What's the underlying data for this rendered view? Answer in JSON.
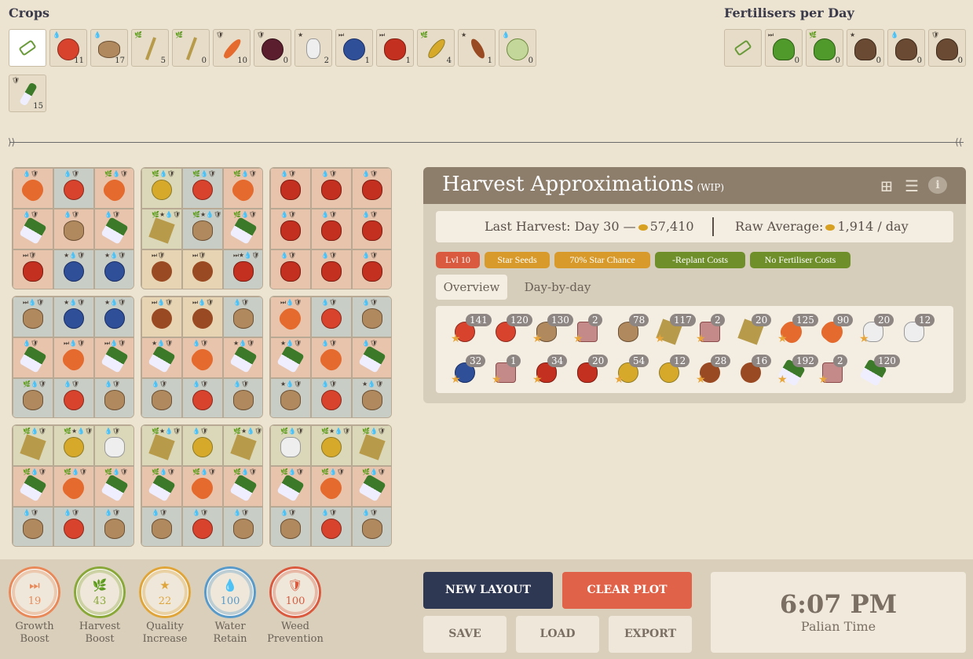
{
  "crops_title": "Crops",
  "fert_title": "Fertilisers per Day",
  "crops": [
    {
      "name": "eraser",
      "count": ""
    },
    {
      "name": "tomato",
      "count": "11",
      "mods": "💧"
    },
    {
      "name": "potato",
      "count": "17",
      "mods": "💧"
    },
    {
      "name": "wheat",
      "count": "5",
      "mods": "🌿"
    },
    {
      "name": "wheat",
      "count": "0",
      "mods": "🌿"
    },
    {
      "name": "carrot",
      "count": "10",
      "mods": "🛡"
    },
    {
      "name": "onion",
      "count": "0",
      "mods": "🛡"
    },
    {
      "name": "cotton",
      "count": "2",
      "mods": "★"
    },
    {
      "name": "blue",
      "count": "1",
      "mods": "⏭"
    },
    {
      "name": "apple",
      "count": "1",
      "mods": "⏭"
    },
    {
      "name": "corn",
      "count": "4",
      "mods": "🌿"
    },
    {
      "name": "chili",
      "count": "1",
      "mods": "★"
    },
    {
      "name": "cabbage",
      "count": "0",
      "mods": "💧"
    },
    {
      "name": "leek",
      "count": "15",
      "mods": "🛡"
    }
  ],
  "fertilisers": [
    {
      "name": "eraser",
      "count": ""
    },
    {
      "name": "green",
      "count": "0",
      "mods": "⏭"
    },
    {
      "name": "green",
      "count": "0",
      "mods": "🌿"
    },
    {
      "name": "manure",
      "count": "0",
      "mods": "★"
    },
    {
      "name": "manure",
      "count": "0",
      "mods": "💧"
    },
    {
      "name": "manure",
      "count": "0",
      "mods": "🛡"
    }
  ],
  "plots": [
    [
      [
        "carrot",
        "salmon",
        "💧🛡"
      ],
      [
        "tomato",
        "blue",
        "💧🛡"
      ],
      [
        "carrot",
        "salmon",
        "🌿💧🛡"
      ],
      [
        "leek",
        "salmon",
        "💧🛡"
      ],
      [
        "potato",
        "salmon",
        "💧🛡"
      ],
      [
        "leek",
        "salmon",
        "💧🛡"
      ],
      [
        "apple",
        "salmon",
        "⏭🛡"
      ],
      [
        "blue",
        "blue",
        "★💧🛡"
      ],
      [
        "blue",
        "blue",
        "★💧🛡"
      ]
    ],
    [
      [
        "corn",
        "olive",
        "🌿💧🛡"
      ],
      [
        "tomato",
        "blue",
        "🌿💧🛡"
      ],
      [
        "carrot",
        "salmon",
        "🌿💧🛡"
      ],
      [
        "wheat",
        "olive",
        "🌿★💧🛡"
      ],
      [
        "potato",
        "blue",
        "🌿★💧🛡"
      ],
      [
        "leek",
        "salmon",
        "🌿💧🛡"
      ],
      [
        "chili",
        "tan",
        "⏭🛡"
      ],
      [
        "chili",
        "tan",
        "⏭🛡"
      ],
      [
        "apple",
        "blue",
        "⏭★💧🛡"
      ]
    ],
    [
      [
        "apple",
        "salmon",
        "💧🛡"
      ],
      [
        "apple",
        "salmon",
        "💧🛡"
      ],
      [
        "apple",
        "salmon",
        "💧🛡"
      ],
      [
        "apple",
        "salmon",
        "💧🛡"
      ],
      [
        "apple",
        "salmon",
        "💧🛡"
      ],
      [
        "apple",
        "salmon",
        "💧🛡"
      ],
      [
        "apple",
        "salmon",
        "💧🛡"
      ],
      [
        "apple",
        "salmon",
        "💧🛡"
      ],
      [
        "apple",
        "salmon",
        "💧🛡"
      ]
    ],
    [
      [
        "potato",
        "blue",
        "⏭💧🛡"
      ],
      [
        "blue",
        "blue",
        "★💧🛡"
      ],
      [
        "blue",
        "blue",
        "★💧🛡"
      ],
      [
        "leek",
        "salmon",
        "💧🛡"
      ],
      [
        "carrot",
        "salmon",
        "⏭💧🛡"
      ],
      [
        "leek",
        "salmon",
        "⏭💧🛡"
      ],
      [
        "potato",
        "blue",
        "🌿💧🛡"
      ],
      [
        "tomato",
        "blue",
        "💧🛡"
      ],
      [
        "potato",
        "blue",
        "💧🛡"
      ]
    ],
    [
      [
        "chili",
        "tan",
        "⏭💧🛡"
      ],
      [
        "chili",
        "tan",
        "⏭💧🛡"
      ],
      [
        "potato",
        "blue",
        "💧🛡"
      ],
      [
        "leek",
        "salmon",
        "★💧🛡"
      ],
      [
        "carrot",
        "salmon",
        "💧🛡"
      ],
      [
        "leek",
        "salmon",
        "★💧🛡"
      ],
      [
        "potato",
        "blue",
        "💧🛡"
      ],
      [
        "tomato",
        "blue",
        "💧🛡"
      ],
      [
        "potato",
        "blue",
        "💧🛡"
      ]
    ],
    [
      [
        "carrot",
        "salmon",
        "⏭💧🛡"
      ],
      [
        "tomato",
        "blue",
        "💧🛡"
      ],
      [
        "potato",
        "blue",
        "💧🛡"
      ],
      [
        "leek",
        "salmon",
        "★💧🛡"
      ],
      [
        "carrot",
        "salmon",
        "💧🛡"
      ],
      [
        "leek",
        "salmon",
        "💧🛡"
      ],
      [
        "potato",
        "blue",
        "★💧🛡"
      ],
      [
        "tomato",
        "blue",
        "💧🛡"
      ],
      [
        "potato",
        "blue",
        "★💧🛡"
      ]
    ],
    [
      [
        "wheat",
        "olive",
        "🌿💧🛡"
      ],
      [
        "corn",
        "olive",
        "🌿★💧🛡"
      ],
      [
        "cotton",
        "olive",
        "💧🛡"
      ],
      [
        "leek",
        "salmon",
        "🌿💧🛡"
      ],
      [
        "carrot",
        "salmon",
        "🌿💧🛡"
      ],
      [
        "leek",
        "salmon",
        "🌿💧🛡"
      ],
      [
        "potato",
        "blue",
        "💧🛡"
      ],
      [
        "tomato",
        "blue",
        "💧🛡"
      ],
      [
        "potato",
        "blue",
        "💧🛡"
      ]
    ],
    [
      [
        "wheat",
        "olive",
        "🌿★💧🛡"
      ],
      [
        "corn",
        "olive",
        "💧🛡"
      ],
      [
        "wheat",
        "olive",
        "🌿★💧🛡"
      ],
      [
        "leek",
        "salmon",
        "🌿💧🛡"
      ],
      [
        "carrot",
        "salmon",
        "🌿💧🛡"
      ],
      [
        "leek",
        "salmon",
        "🌿💧🛡"
      ],
      [
        "potato",
        "blue",
        "💧🛡"
      ],
      [
        "tomato",
        "blue",
        "💧🛡"
      ],
      [
        "potato",
        "blue",
        "💧🛡"
      ]
    ],
    [
      [
        "cotton",
        "olive",
        "🌿💧🛡"
      ],
      [
        "corn",
        "olive",
        "🌿★💧🛡"
      ],
      [
        "wheat",
        "olive",
        "🌿💧🛡"
      ],
      [
        "leek",
        "salmon",
        "🌿💧🛡"
      ],
      [
        "carrot",
        "salmon",
        "🌿💧🛡"
      ],
      [
        "leek",
        "salmon",
        "🌿💧🛡"
      ],
      [
        "potato",
        "blue",
        "💧🛡"
      ],
      [
        "tomato",
        "blue",
        "💧🛡"
      ],
      [
        "potato",
        "blue",
        "💧🛡"
      ]
    ]
  ],
  "panel": {
    "title": "Harvest Approximations",
    "wip": "(WIP)",
    "last_harvest_label": "Last Harvest: Day 30 —",
    "last_harvest_value": "57,410",
    "raw_avg_label": "Raw Average:",
    "raw_avg_value": "1,914 / day",
    "tags": [
      "Lvl 10",
      "Star Seeds",
      "70% Star Chance",
      "-Replant Costs",
      "No Fertiliser Costs"
    ],
    "tag_colors": [
      "#d95a3e",
      "#d89a2a",
      "#d89a2a",
      "#6f8f2a",
      "#6f8f2a"
    ],
    "tabs": [
      "Overview",
      "Day-by-day"
    ],
    "harvest": [
      [
        "tomato",
        "141",
        true
      ],
      [
        "tomato",
        "120",
        false
      ],
      [
        "potato",
        "130",
        true
      ],
      [
        "seedbag",
        "2",
        true
      ],
      [
        "potato",
        "78",
        false
      ],
      [
        "wheat",
        "117",
        true
      ],
      [
        "seedbag",
        "2",
        true
      ],
      [
        "wheat",
        "20",
        false
      ],
      [
        "carrot",
        "125",
        true
      ],
      [
        "carrot",
        "90",
        false
      ],
      [
        "cotton",
        "20",
        true
      ],
      [
        "cotton",
        "12",
        false
      ],
      [
        "blue",
        "32",
        true
      ],
      [
        "seedbag",
        "1",
        true
      ],
      [
        "apple",
        "34",
        true
      ],
      [
        "apple",
        "20",
        false
      ],
      [
        "corn",
        "54",
        true
      ],
      [
        "corn",
        "12",
        false
      ],
      [
        "chili",
        "28",
        true
      ],
      [
        "chili",
        "16",
        false
      ],
      [
        "leek",
        "192",
        true
      ],
      [
        "seedbag",
        "2",
        true
      ],
      [
        "leek",
        "120",
        false
      ]
    ]
  },
  "rings": [
    {
      "label": "Growth Boost",
      "value": "19",
      "icon": "⏭",
      "color": "#e8895a"
    },
    {
      "label": "Harvest Boost",
      "value": "43",
      "icon": "🌿",
      "color": "#8aa83a"
    },
    {
      "label": "Quality Increase",
      "value": "22",
      "icon": "★",
      "color": "#e0a53a"
    },
    {
      "label": "Water Retain",
      "value": "100",
      "icon": "💧",
      "color": "#5a9ac8"
    },
    {
      "label": "Weed Prevention",
      "value": "100",
      "icon": "🛡",
      "color": "#d95a3e"
    }
  ],
  "buttons": {
    "new_layout": "NEW LAYOUT",
    "clear_plot": "CLEAR PLOT",
    "save": "SAVE",
    "load": "LOAD",
    "export": "EXPORT"
  },
  "time": {
    "value": "6:07 PM",
    "label": "Palian Time"
  }
}
